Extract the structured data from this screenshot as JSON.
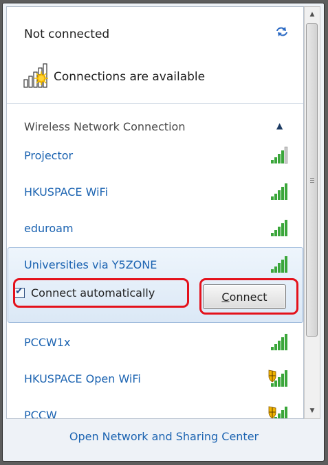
{
  "status": {
    "title": "Not connected",
    "subtitle": "Connections are available",
    "refresh_icon": "refresh-arrows-icon",
    "signal_icon": "signal-warning-icon"
  },
  "section": {
    "title": "Wireless Network Connection",
    "collapse_icon": "chevron-up-icon"
  },
  "networks": [
    {
      "name": "Projector",
      "bars": 4,
      "secured_warning": false
    },
    {
      "name": "HKUSPACE WiFi",
      "bars": 5,
      "secured_warning": false
    },
    {
      "name": "eduroam",
      "bars": 5,
      "secured_warning": false
    },
    {
      "name": "Universities via Y5ZONE",
      "bars": 5,
      "secured_warning": false,
      "selected": true
    },
    {
      "name": "PCCW1x",
      "bars": 5,
      "secured_warning": false
    },
    {
      "name": "HKUSPACE Open WiFi",
      "bars": 5,
      "secured_warning": true
    },
    {
      "name": "PCCW",
      "bars": 5,
      "secured_warning": true
    }
  ],
  "selected_actions": {
    "connect_auto_label": "Connect automatically",
    "connect_auto_checked": true,
    "connect_button_hotkey": "C",
    "connect_button_rest": "onnect"
  },
  "footer": {
    "link": "Open Network and Sharing Center"
  },
  "colors": {
    "link": "#1b63b1",
    "highlight": "#e4111b",
    "signal": "#3aa63a"
  }
}
